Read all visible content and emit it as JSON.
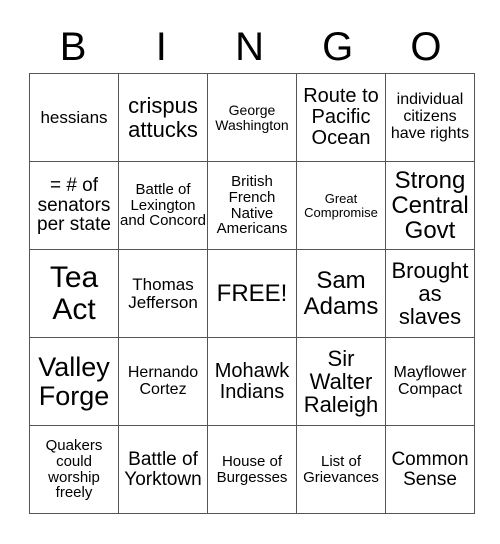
{
  "header": [
    "B",
    "I",
    "N",
    "G",
    "O"
  ],
  "rows": [
    [
      "hessians",
      "crispus attucks",
      "George Washington",
      "Route to Pacific Ocean",
      "individual citizens have rights"
    ],
    [
      "= # of senators per state",
      "Battle of Lexington and Concord",
      "British French Native Americans",
      "Great Compromise",
      "Strong Central Govt"
    ],
    [
      "Tea Act",
      "Thomas Jefferson",
      "FREE!",
      "Sam Adams",
      "Brought as slaves"
    ],
    [
      "Valley Forge",
      "Hernando Cortez",
      "Mohawk Indians",
      "Sir Walter Raleigh",
      "Mayflower Compact"
    ],
    [
      "Quakers could worship freely",
      "Battle of Yorktown",
      "House of Burgesses",
      "List of Grievances",
      "Common Sense"
    ]
  ]
}
